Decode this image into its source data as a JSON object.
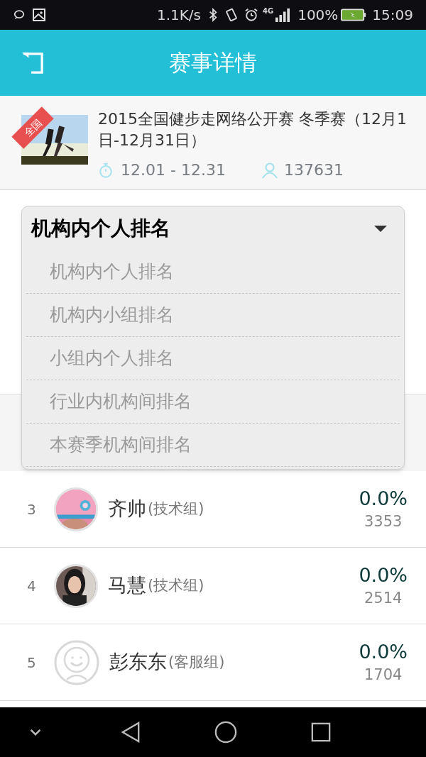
{
  "status_bar": {
    "speed": "1.1K/s",
    "network": "4G",
    "battery": "100%",
    "time": "15:09"
  },
  "header": {
    "title": "赛事详情"
  },
  "event": {
    "badge": "全国",
    "title": "2015全国健步走网络公开赛 冬季赛（12月1日-12月31日）",
    "dates": "12.01 - 12.31",
    "participants": "137631"
  },
  "dropdown": {
    "value": "机构内个人排名",
    "options": [
      "机构内个人排名",
      "机构内小组排名",
      "小组内个人排名",
      "行业内机构间排名",
      "本赛季机构间排名"
    ]
  },
  "rows": [
    {
      "rank": "3",
      "name": "齐帅",
      "group": "(技术组)",
      "rate": "0.0%",
      "steps": "3353",
      "has_photo": true
    },
    {
      "rank": "4",
      "name": "马慧",
      "group": "(技术组)",
      "rate": "0.0%",
      "steps": "2514",
      "has_photo": true
    },
    {
      "rank": "5",
      "name": "彭东东",
      "group": "(客服组)",
      "rate": "0.0%",
      "steps": "1704",
      "has_photo": false
    }
  ]
}
